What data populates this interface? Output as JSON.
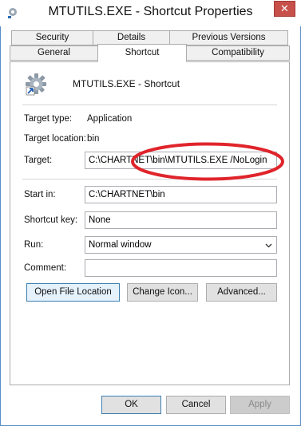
{
  "window": {
    "title": "MTUTILS.EXE - Shortcut Properties",
    "close_glyph": "✕",
    "title_icon": "shortcut-gear-icon"
  },
  "tabs": {
    "row1": [
      "Security",
      "Details",
      "Previous Versions"
    ],
    "row2": [
      "General",
      "Shortcut",
      "Compatibility"
    ],
    "active": "Shortcut"
  },
  "header": {
    "name": "MTUTILS.EXE - Shortcut",
    "icon": "gear-shortcut-icon"
  },
  "info": {
    "target_type_label": "Target type:",
    "target_type_value": "Application",
    "target_location_label": "Target location:",
    "target_location_value": "bin",
    "target_label": "Target:",
    "target_value": "C:\\CHARTNET\\bin\\MTUTILS.EXE /NoLogin"
  },
  "form": {
    "start_in_label": "Start in:",
    "start_in_value": "C:\\CHARTNET\\bin",
    "shortcut_key_label": "Shortcut key:",
    "shortcut_key_value": "None",
    "run_label": "Run:",
    "run_value": "Normal window",
    "comment_label": "Comment:",
    "comment_value": ""
  },
  "actions": {
    "open_file_location": "Open File Location",
    "change_icon": "Change Icon...",
    "advanced": "Advanced..."
  },
  "footer": {
    "ok": "OK",
    "cancel": "Cancel",
    "apply": "Apply"
  },
  "colors": {
    "annotation_ellipse": "#e0242b",
    "close_button": "#c7504b",
    "frame_border": "#5a8fc7"
  }
}
